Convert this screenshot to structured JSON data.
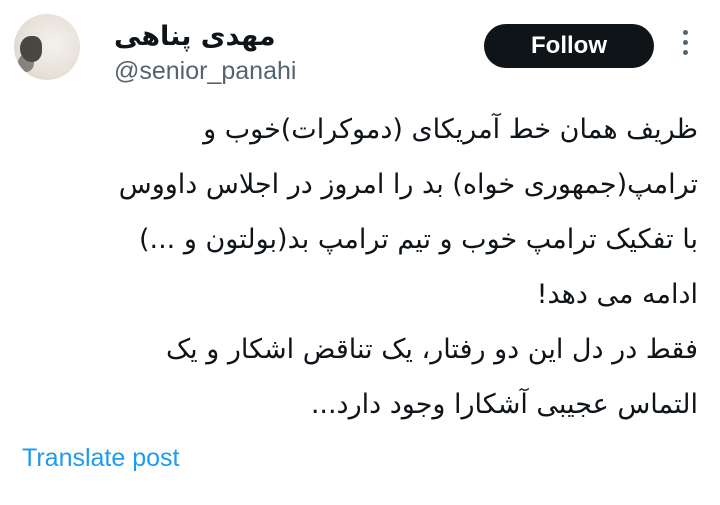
{
  "author": {
    "display_name": "مهدی پناهی",
    "username": "@senior_panahi",
    "avatar_icon": "profile-avatar"
  },
  "header": {
    "follow_label": "Follow",
    "more_icon": "more-dots-vertical-icon"
  },
  "tweet": {
    "lines": [
      "ظریف همان خط آمریکای (دموکرات)خوب و",
      "ترامپ(جمهوری خواه) بد را امروز در اجلاس داووس",
      "با تفکیک ترامپ خوب و تیم ترامپ بد(بولتون و ...)",
      "ادامه می دهد!",
      "فقط در دل این دو رفتار، یک تناقض اشکار و یک",
      "التماس عجیبی آشکارا وجود دارد..."
    ]
  },
  "footer": {
    "translate_label": "Translate post"
  },
  "colors": {
    "text": "#0f1419",
    "secondary": "#536471",
    "link": "#1d9bf0",
    "button_bg": "#0f1419"
  }
}
